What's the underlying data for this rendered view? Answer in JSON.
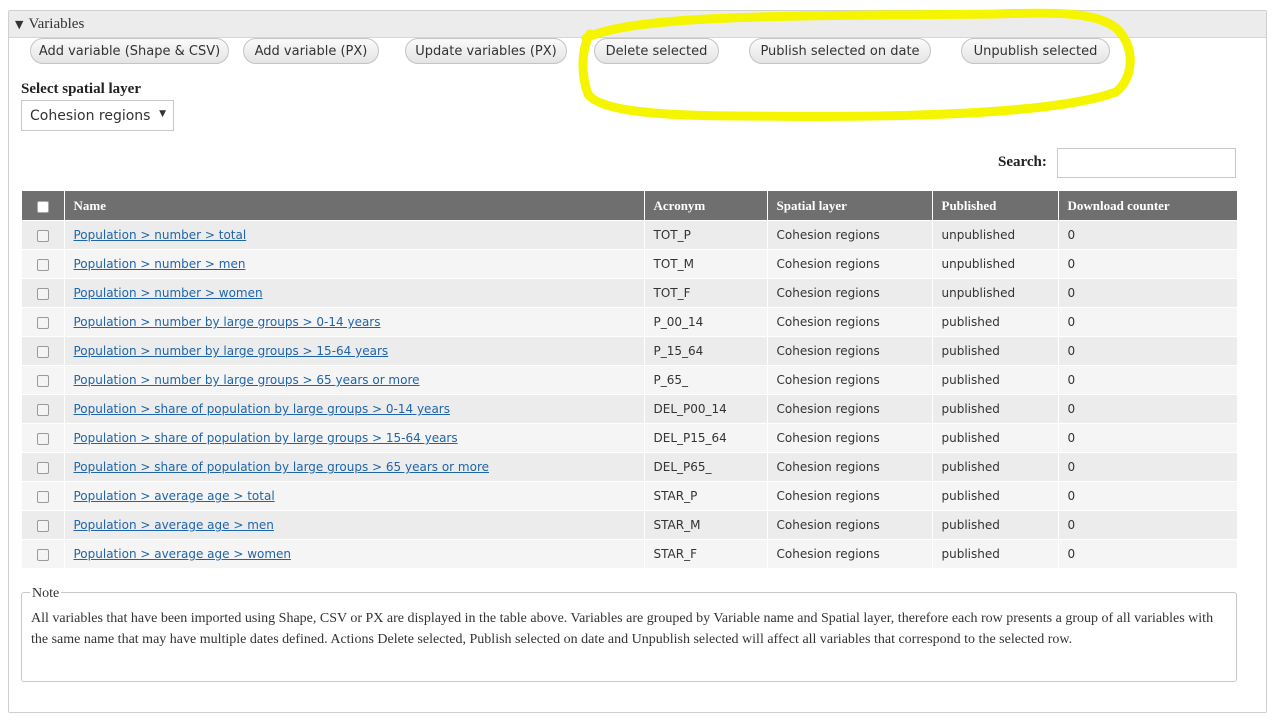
{
  "section": {
    "title": "Variables",
    "toggle_icon": "triangle-down-icon"
  },
  "actions": {
    "add_shape_csv": "Add variable (Shape & CSV)",
    "add_px": "Add variable (PX)",
    "update_px": "Update variables (PX)",
    "delete_selected": "Delete selected",
    "publish_on_date": "Publish selected on date",
    "unpublish_selected": "Unpublish selected"
  },
  "highlight_color": "#f5f500",
  "spatial_layer": {
    "label": "Select spatial layer",
    "selected": "Cohesion regions"
  },
  "search": {
    "label": "Search:",
    "value": ""
  },
  "table": {
    "columns": [
      "Name",
      "Acronym",
      "Spatial layer",
      "Published",
      "Download counter"
    ],
    "rows": [
      {
        "name": "Population > number > total",
        "acronym": "TOT_P",
        "layer": "Cohesion regions",
        "published": "unpublished",
        "downloads": "0"
      },
      {
        "name": "Population > number > men",
        "acronym": "TOT_M",
        "layer": "Cohesion regions",
        "published": "unpublished",
        "downloads": "0"
      },
      {
        "name": "Population > number > women",
        "acronym": "TOT_F",
        "layer": "Cohesion regions",
        "published": "unpublished",
        "downloads": "0"
      },
      {
        "name": "Population > number by large groups > 0-14 years",
        "acronym": "P_00_14",
        "layer": "Cohesion regions",
        "published": "published",
        "downloads": "0"
      },
      {
        "name": "Population > number by large groups > 15-64 years",
        "acronym": "P_15_64",
        "layer": "Cohesion regions",
        "published": "published",
        "downloads": "0"
      },
      {
        "name": "Population > number by large groups > 65 years or more",
        "acronym": "P_65_",
        "layer": "Cohesion regions",
        "published": "published",
        "downloads": "0"
      },
      {
        "name": "Population > share of population by large groups > 0-14 years",
        "acronym": "DEL_P00_14",
        "layer": "Cohesion regions",
        "published": "published",
        "downloads": "0"
      },
      {
        "name": "Population > share of population by large groups > 15-64 years",
        "acronym": "DEL_P15_64",
        "layer": "Cohesion regions",
        "published": "published",
        "downloads": "0"
      },
      {
        "name": "Population > share of population by large groups > 65 years or more",
        "acronym": "DEL_P65_",
        "layer": "Cohesion regions",
        "published": "published",
        "downloads": "0"
      },
      {
        "name": "Population > average age > total",
        "acronym": "STAR_P",
        "layer": "Cohesion regions",
        "published": "published",
        "downloads": "0"
      },
      {
        "name": "Population > average age > men",
        "acronym": "STAR_M",
        "layer": "Cohesion regions",
        "published": "published",
        "downloads": "0"
      },
      {
        "name": "Population > average age > women",
        "acronym": "STAR_F",
        "layer": "Cohesion regions",
        "published": "published",
        "downloads": "0"
      }
    ]
  },
  "note": {
    "title": "Note",
    "text": "All variables that have been imported using Shape, CSV or PX are displayed in the table above. Variables are grouped by Variable name and Spatial layer, therefore each row presents a group of all variables with the same name that may have multiple dates defined. Actions Delete selected, Publish selected on date and Unpublish selected will affect all variables that correspond to the selected row."
  }
}
